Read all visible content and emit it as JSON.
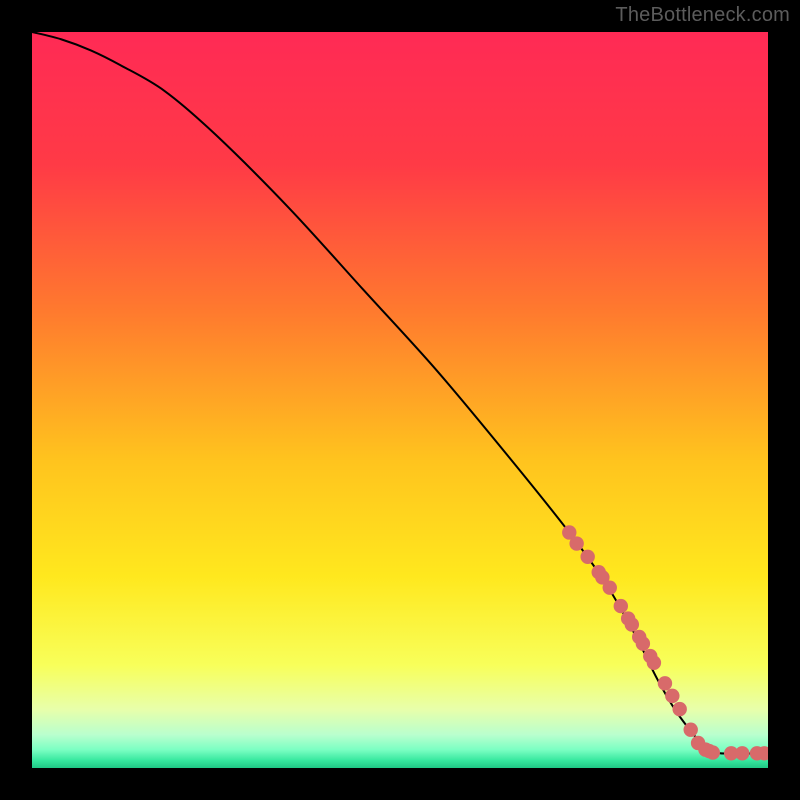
{
  "watermark": "TheBottleneck.com",
  "colors": {
    "background": "#000000",
    "curve": "#000000",
    "marker": "#d86a6a",
    "gradient_stops": [
      {
        "offset": 0.0,
        "color": "#ff2a55"
      },
      {
        "offset": 0.18,
        "color": "#ff3a46"
      },
      {
        "offset": 0.38,
        "color": "#ff7a2e"
      },
      {
        "offset": 0.58,
        "color": "#ffc31e"
      },
      {
        "offset": 0.74,
        "color": "#ffe81e"
      },
      {
        "offset": 0.86,
        "color": "#f8ff5a"
      },
      {
        "offset": 0.92,
        "color": "#e8ffaa"
      },
      {
        "offset": 0.955,
        "color": "#b9ffce"
      },
      {
        "offset": 0.975,
        "color": "#7cffc3"
      },
      {
        "offset": 0.99,
        "color": "#35e79e"
      },
      {
        "offset": 1.0,
        "color": "#1fc885"
      }
    ]
  },
  "chart_data": {
    "type": "line",
    "title": "",
    "xlabel": "",
    "ylabel": "",
    "xlim": [
      0,
      100
    ],
    "ylim": [
      0,
      100
    ],
    "series": [
      {
        "name": "curve",
        "x": [
          0,
          4,
          8,
          12,
          18,
          25,
          35,
          45,
          55,
          65,
          73,
          78,
          82,
          85,
          88,
          92,
          96,
          100
        ],
        "values": [
          100,
          99,
          97.5,
          95.5,
          92,
          86,
          76,
          65,
          54,
          42,
          32,
          25,
          18,
          12,
          7,
          2.5,
          2,
          2
        ]
      }
    ],
    "highlight_points": {
      "name": "cluster",
      "x": [
        73,
        74,
        75.5,
        77,
        77.5,
        78.5,
        80,
        81,
        81.5,
        82.5,
        83,
        84,
        84.5,
        86,
        87,
        88,
        89.5,
        90.5,
        91.5,
        92,
        92.5,
        95,
        96.5,
        98.5,
        99.5
      ],
      "values": [
        32,
        30.5,
        28.7,
        26.6,
        25.9,
        24.5,
        22,
        20.3,
        19.5,
        17.8,
        16.9,
        15.2,
        14.3,
        11.5,
        9.8,
        8,
        5.2,
        3.4,
        2.5,
        2.3,
        2.1,
        2,
        2,
        2,
        2
      ]
    }
  }
}
